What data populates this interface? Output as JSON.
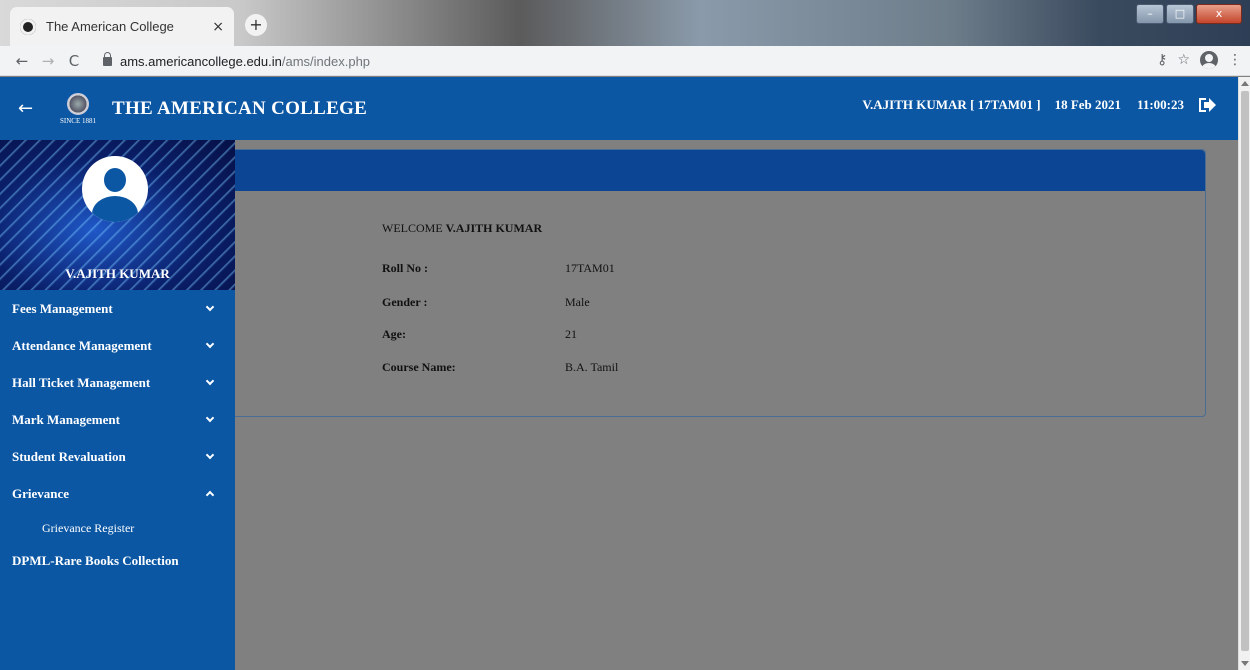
{
  "browser": {
    "tab_title": "The American College",
    "tab_close": "×",
    "new_tab": "+",
    "url_host": "ams.americancollege.edu.in",
    "url_path": "/ams/index.php",
    "back": "←",
    "forward": "→",
    "reload": "C",
    "key_icon": "⚷",
    "star_icon": "☆",
    "menu_icon": "⋮",
    "window_min": "–",
    "window_max": "□",
    "window_close": "x"
  },
  "header": {
    "back_arrow": "←",
    "since": "SINCE 1881",
    "college_name": "THE AMERICAN COLLEGE",
    "student": "V.AJITH KUMAR [ 17TAM01 ]",
    "date": "18 Feb 2021",
    "time": "11:00:23"
  },
  "sidebar": {
    "profile_name": "V.AJITH KUMAR",
    "items": [
      {
        "label": "Fees Management",
        "expanded": false
      },
      {
        "label": "Attendance Management",
        "expanded": false
      },
      {
        "label": "Hall Ticket Management",
        "expanded": false
      },
      {
        "label": "Mark Management",
        "expanded": false
      },
      {
        "label": "Student Revaluation",
        "expanded": false
      },
      {
        "label": "Grievance",
        "expanded": true
      }
    ],
    "subitems": [
      "Grievance Register"
    ],
    "extra_item": "DPML-Rare Books Collection"
  },
  "main": {
    "welcome_prefix": "WELCOME",
    "welcome_name": "V.AJITH KUMAR",
    "rows": [
      {
        "label": "Roll No :",
        "value": "17TAM01"
      },
      {
        "label": "Gender :",
        "value": "Male"
      },
      {
        "label": "Age:",
        "value": "21"
      },
      {
        "label": "Course Name:",
        "value": "B.A. Tamil"
      }
    ]
  },
  "colors": {
    "header_blue": "#0b57a4",
    "card_header_blue": "#0c4593",
    "overlay_gray": "#808080"
  }
}
